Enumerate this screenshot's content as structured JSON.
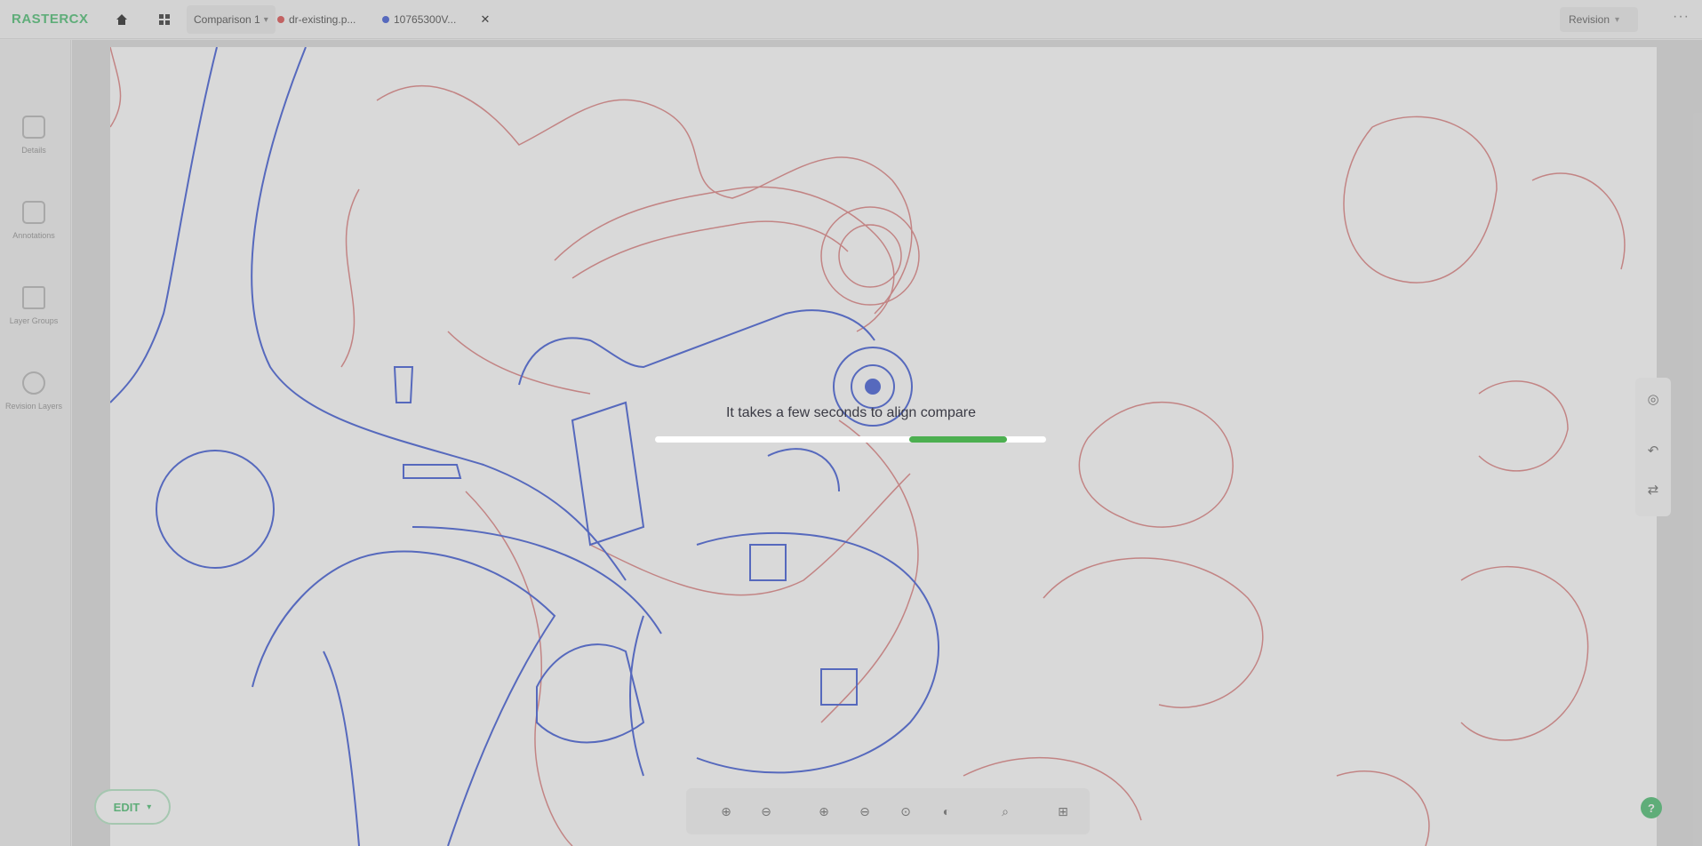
{
  "app": {
    "logo": "RASTERCX"
  },
  "tabs": [
    {
      "label": "Comparison 1",
      "dot_color": null,
      "active": true,
      "has_caret": true
    },
    {
      "label": "dr-existing.p...",
      "dot_color": "#e05a5a",
      "active": false,
      "has_caret": false
    },
    {
      "label": "10765300V...",
      "dot_color": "#4a64d8",
      "active": false,
      "has_caret": false
    }
  ],
  "topbar": {
    "revision_label": "Revision",
    "more_label": "···",
    "home_icon": "home-icon",
    "grid_icon": "grid-icon",
    "close_icon": "close-icon"
  },
  "sidebar": {
    "items": [
      {
        "label": "Details",
        "icon": "details-icon"
      },
      {
        "label": "Annotations",
        "icon": "annotations-icon"
      },
      {
        "label": "Layer Groups",
        "icon": "layer-groups-icon"
      },
      {
        "label": "Revision Layers",
        "icon": "revision-layers-icon"
      }
    ]
  },
  "right_tools": [
    "target-icon",
    "undo-icon",
    "swap-icon"
  ],
  "bottom_toolbar": {
    "edit_label": "EDIT",
    "tools": [
      "zoom-in-icon",
      "zoom-out-icon",
      "zoom-fit-icon",
      "zoom-width-icon",
      "zoom-page-icon",
      "contrast-icon",
      "search-icon",
      "layout-icon"
    ]
  },
  "overlay": {
    "message": "It takes a few seconds to align compare",
    "progress_fraction_start": 0.65,
    "progress_fraction_end": 0.9
  },
  "colors": {
    "brand": "#56c27a",
    "drawing_a": "#e08a8a",
    "drawing_b": "#4a64d8",
    "progress": "#4caf50"
  }
}
